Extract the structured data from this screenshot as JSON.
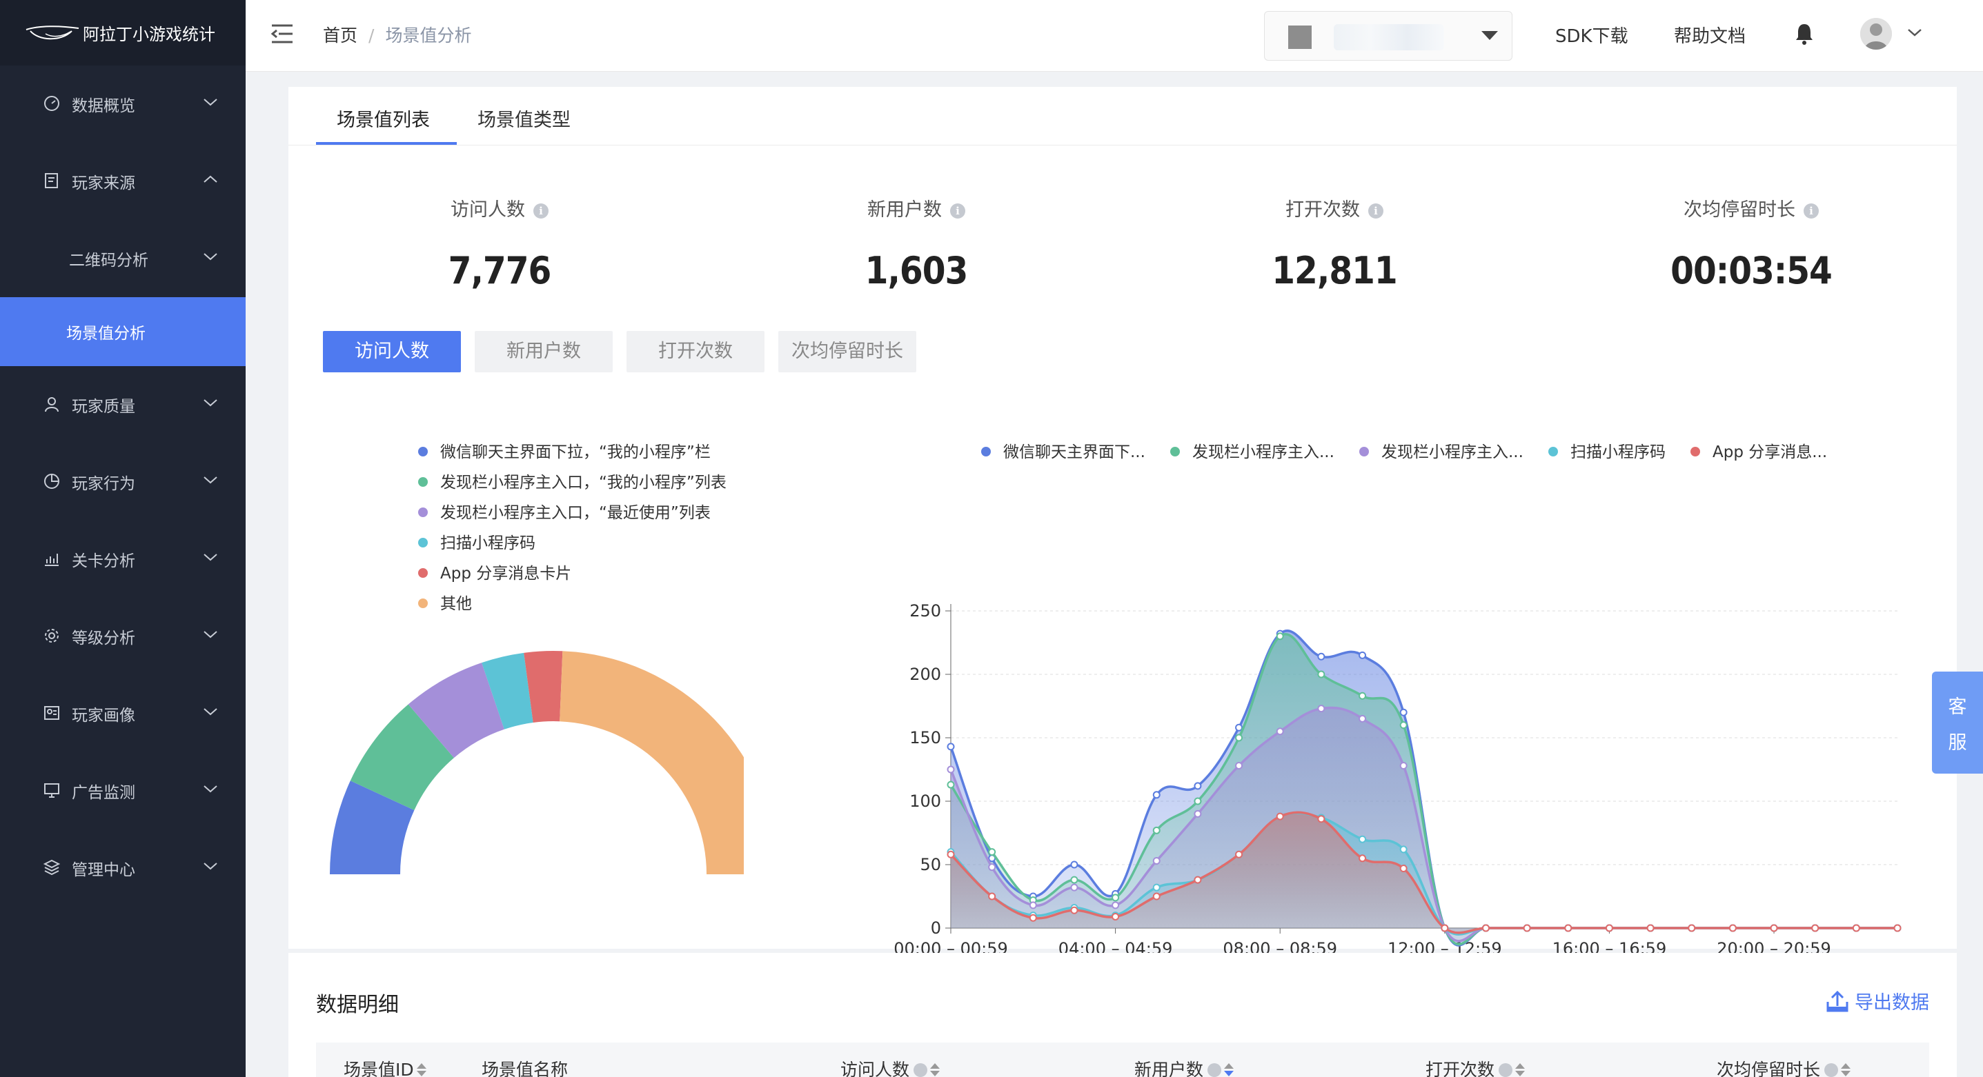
{
  "app": {
    "logo_text": "阿拉丁小游戏统计"
  },
  "sidebar": {
    "items": [
      {
        "label": "数据概览",
        "icon": "dashboard-icon"
      },
      {
        "label": "玩家来源",
        "icon": "source-icon"
      },
      {
        "label": "二维码分析",
        "sub": true
      },
      {
        "label": "场景值分析",
        "sub": true,
        "active": true
      },
      {
        "label": "玩家质量",
        "icon": "user-icon"
      },
      {
        "label": "玩家行为",
        "icon": "pie-icon"
      },
      {
        "label": "关卡分析",
        "icon": "level-chart-icon"
      },
      {
        "label": "等级分析",
        "icon": "gear-icon"
      },
      {
        "label": "玩家画像",
        "icon": "profile-icon"
      },
      {
        "label": "广告监测",
        "icon": "monitor-icon"
      },
      {
        "label": "管理中心",
        "icon": "layers-icon"
      }
    ]
  },
  "header": {
    "breadcrumb_home": "首页",
    "breadcrumb_sep": "/",
    "breadcrumb_current": "场景值分析",
    "sdk_link": "SDK下载",
    "help_link": "帮助文档"
  },
  "tabs": [
    {
      "label": "场景值列表",
      "active": true
    },
    {
      "label": "场景值类型",
      "active": false
    }
  ],
  "metrics": [
    {
      "label": "访问人数",
      "value": "7,776"
    },
    {
      "label": "新用户数",
      "value": "1,603"
    },
    {
      "label": "打开次数",
      "value": "12,811"
    },
    {
      "label": "次均停留时长",
      "value": "00:03:54"
    }
  ],
  "segments": [
    {
      "label": "访问人数",
      "active": true
    },
    {
      "label": "新用户数",
      "active": false
    },
    {
      "label": "打开次数",
      "active": false
    },
    {
      "label": "次均停留时长",
      "active": false
    }
  ],
  "colors": {
    "accent": "#4f7af0",
    "series": [
      "#5b7ddf",
      "#5fbf98",
      "#a48fd9",
      "#5cc3d6",
      "#e06c6c",
      "#f2b47a"
    ]
  },
  "chart_data": [
    {
      "type": "pie",
      "variant": "half-donut",
      "legend": [
        "微信聊天主界面下拉，“我的小程序”栏",
        "发现栏小程序主入口，“我的小程序”列表",
        "发现栏小程序主入口，“最近使用”列表",
        "扫描小程序码",
        "App 分享消息卡片",
        "其他"
      ],
      "values": [
        1070,
        1070,
        940,
        480,
        430,
        3786
      ]
    },
    {
      "type": "area",
      "legend": [
        "微信聊天主界面下...",
        "发现栏小程序主入...",
        "发现栏小程序主入...",
        "扫描小程序码",
        "App 分享消息..."
      ],
      "x_ticks": [
        "00:00 – 00:59",
        "04:00 – 04:59",
        "08:00 – 08:59",
        "12:00 – 12:59",
        "16:00 – 16:59",
        "20:00 – 20:59"
      ],
      "y_ticks": [
        0,
        50,
        100,
        150,
        200,
        250
      ],
      "ylim": [
        0,
        250
      ],
      "x": [
        0,
        1,
        2,
        3,
        4,
        5,
        6,
        7,
        8,
        9,
        10,
        11,
        12,
        13,
        14,
        15,
        16,
        17,
        18,
        19,
        20,
        21,
        22,
        23
      ],
      "series": [
        {
          "name": "微信聊天主界面下...",
          "values": [
            143,
            55,
            25,
            50,
            27,
            105,
            112,
            158,
            232,
            214,
            215,
            170,
            0,
            0,
            0,
            0,
            0,
            0,
            0,
            0,
            0,
            0,
            0,
            0
          ]
        },
        {
          "name": "发现栏小程序主入...",
          "values": [
            113,
            60,
            22,
            38,
            24,
            77,
            100,
            150,
            230,
            200,
            183,
            160,
            0,
            0,
            0,
            0,
            0,
            0,
            0,
            0,
            0,
            0,
            0,
            0
          ]
        },
        {
          "name": "发现栏小程序主入...",
          "values": [
            125,
            48,
            18,
            32,
            18,
            53,
            90,
            128,
            155,
            173,
            165,
            128,
            0,
            0,
            0,
            0,
            0,
            0,
            0,
            0,
            0,
            0,
            0,
            0
          ]
        },
        {
          "name": "扫描小程序码",
          "values": [
            60,
            25,
            10,
            16,
            10,
            32,
            38,
            58,
            88,
            87,
            70,
            62,
            0,
            0,
            0,
            0,
            0,
            0,
            0,
            0,
            0,
            0,
            0,
            0
          ]
        },
        {
          "name": "App 分享消息...",
          "values": [
            58,
            25,
            8,
            14,
            9,
            25,
            38,
            58,
            88,
            86,
            55,
            47,
            0,
            0,
            0,
            0,
            0,
            0,
            0,
            0,
            0,
            0,
            0,
            0
          ]
        }
      ]
    }
  ],
  "detail": {
    "title": "数据明细",
    "export_label": "导出数据",
    "columns": [
      "场景值ID",
      "场景值名称",
      "访问人数",
      "新用户数",
      "打开次数",
      "次均停留时长"
    ]
  },
  "kefu": {
    "line1": "客",
    "line2": "服"
  }
}
